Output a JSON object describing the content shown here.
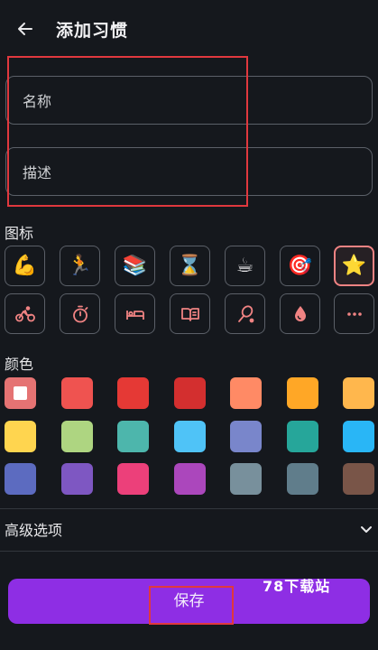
{
  "header": {
    "title": "添加习惯"
  },
  "form": {
    "name_placeholder": "名称",
    "description_placeholder": "描述"
  },
  "icons": {
    "label": "图标",
    "row1": [
      {
        "name": "flexed-biceps-icon",
        "glyph": "💪"
      },
      {
        "name": "running-person-icon",
        "glyph": "🏃"
      },
      {
        "name": "books-icon",
        "glyph": "📚"
      },
      {
        "name": "hourglass-icon",
        "glyph": "⌛"
      },
      {
        "name": "hot-beverage-icon",
        "glyph": "☕"
      },
      {
        "name": "target-icon",
        "glyph": "🎯"
      },
      {
        "name": "star-icon",
        "glyph": "⭐",
        "selected": true
      }
    ],
    "row2": [
      "bicycle-icon",
      "stopwatch-icon",
      "bed-icon",
      "open-book-icon",
      "racket-icon",
      "water-drop-icon",
      "more-icon"
    ],
    "accent": "#f08383"
  },
  "colors": {
    "label": "颜色",
    "swatches": [
      {
        "hex": "#e57373",
        "selected": true
      },
      {
        "hex": "#ef5350"
      },
      {
        "hex": "#e53935"
      },
      {
        "hex": "#d32f2f"
      },
      {
        "hex": "#ff8a65"
      },
      {
        "hex": "#ffa726"
      },
      {
        "hex": "#ffb74d"
      },
      {
        "hex": "#ffd54f"
      },
      {
        "hex": "#aed581"
      },
      {
        "hex": "#4db6ac"
      },
      {
        "hex": "#4fc3f7"
      },
      {
        "hex": "#7986cb"
      },
      {
        "hex": "#26a69a"
      },
      {
        "hex": "#29b6f6"
      },
      {
        "hex": "#5c6bc0"
      },
      {
        "hex": "#7e57c2"
      },
      {
        "hex": "#ec407a"
      },
      {
        "hex": "#ab47bc"
      },
      {
        "hex": "#78909c"
      },
      {
        "hex": "#607d8b"
      },
      {
        "hex": "#795548"
      }
    ]
  },
  "advanced": {
    "label": "高级选项"
  },
  "save": {
    "label": "保存",
    "color": "#8e2ee4"
  },
  "watermark": "78下载站"
}
